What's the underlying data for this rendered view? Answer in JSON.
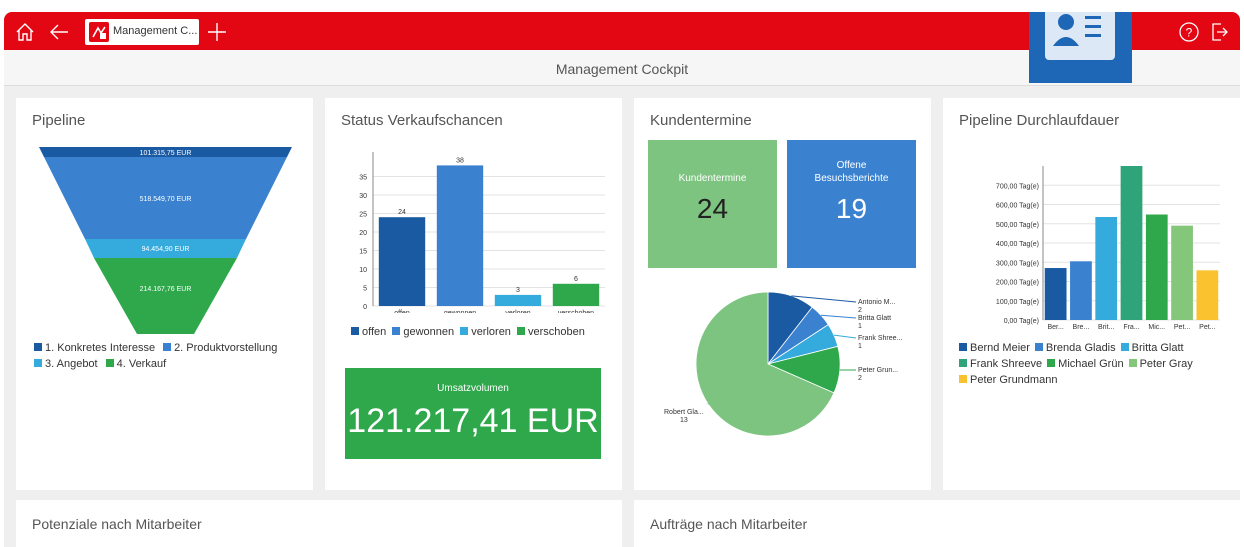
{
  "app": {
    "tab_label": "Management C...",
    "page_title": "Management Cockpit"
  },
  "icons": {
    "home": "home-icon",
    "back": "back-arrow-icon",
    "add_tab": "plus-icon",
    "contact": "contact-card-icon",
    "help": "help-icon",
    "logout": "logout-icon"
  },
  "pipeline": {
    "title": "Pipeline",
    "stages": [
      {
        "label": "101.315,75 EUR",
        "color": "#1a5aa3"
      },
      {
        "label": "518.549,70 EUR",
        "color": "#3a82d0"
      },
      {
        "label": "94.454,90 EUR",
        "color": "#35aadc"
      },
      {
        "label": "214.167,76 EUR",
        "color": "#2ea84b"
      }
    ],
    "legend": [
      "1. Konkretes Interesse",
      "2. Produktvorstellung",
      "3. Angebot",
      "4. Verkauf"
    ]
  },
  "status": {
    "title": "Status Verkaufschancen",
    "chart_data": {
      "type": "bar",
      "categories": [
        "offen",
        "gewonnen",
        "verloren",
        "verschoben"
      ],
      "values": [
        24,
        38,
        3,
        6
      ],
      "colors": [
        "#1a5aa3",
        "#3a82d0",
        "#35aadc",
        "#2ea84b"
      ],
      "ylim": [
        0,
        40
      ],
      "yticks": [
        "0",
        "5",
        "10",
        "15",
        "20",
        "25",
        "30",
        "35"
      ]
    },
    "legend": [
      "offen",
      "gewonnen",
      "verloren",
      "verschoben"
    ]
  },
  "umsatz": {
    "label": "Umsatzvolumen",
    "value": "121.217,41 EUR"
  },
  "kunden": {
    "title": "Kundentermine",
    "tile1_label": "Kundentermine",
    "tile1_value": "24",
    "tile2_label_1": "Offene",
    "tile2_label_2": "Besuchsberichte",
    "tile2_value": "19",
    "chart_data": {
      "type": "pie",
      "slices": [
        {
          "name": "Antonio M...",
          "value": 2,
          "color": "#1a5aa3"
        },
        {
          "name": "Britta Glatt",
          "value": 1,
          "color": "#3a82d0"
        },
        {
          "name": "Frank Shree...",
          "value": 1,
          "color": "#35aadc"
        },
        {
          "name": "Peter Grun...",
          "value": 2,
          "color": "#2ea84b"
        },
        {
          "name": "Robert Gla...",
          "value": 13,
          "color": "#7cc47f"
        }
      ]
    }
  },
  "durchlauf": {
    "title": "Pipeline Durchlaufdauer",
    "chart_data": {
      "type": "bar",
      "categories": [
        "Ber...",
        "Bre...",
        "Brit...",
        "Fra...",
        "Mic...",
        "Pet...",
        "Pet..."
      ],
      "values": [
        270,
        305,
        535,
        800,
        548,
        490,
        258
      ],
      "colors": [
        "#1a5aa3",
        "#3a82d0",
        "#35aadc",
        "#2fa37a",
        "#2ea84b",
        "#84c77a",
        "#f9c22e"
      ],
      "ylim": [
        0,
        800
      ],
      "yticks": [
        "0,00 Tag(e)",
        "100,00 Tag(e)",
        "200,00 Tag(e)",
        "300,00 Tag(e)",
        "400,00 Tag(e)",
        "500,00 Tag(e)",
        "600,00 Tag(e)",
        "700,00 Tag(e)"
      ]
    },
    "legend": [
      "Bernd Meier",
      "Brenda Gladis",
      "Britta Glatt",
      "Frank Shreeve",
      "Michael Grün",
      "Peter Gray",
      "Peter Grundmann"
    ]
  },
  "potenziale": {
    "title": "Potenziale nach Mitarbeiter"
  },
  "auftraege": {
    "title": "Aufträge nach Mitarbeiter"
  }
}
